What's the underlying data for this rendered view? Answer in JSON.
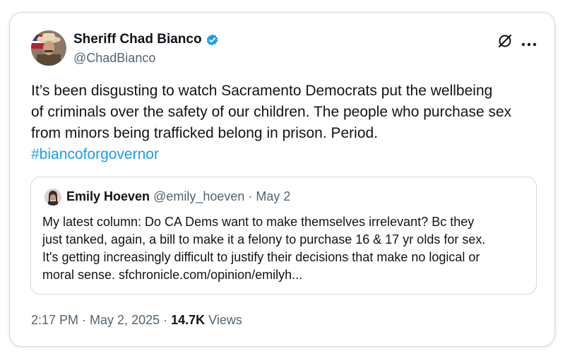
{
  "author": {
    "name": "Sheriff Chad Bianco",
    "handle": "@ChadBianco"
  },
  "tweet": {
    "text_lines": [
      "It’s been disgusting to watch Sacramento Democrats put the wellbeing",
      "of criminals over the safety of our children. The people who purchase sex",
      "from minors being trafficked belong in prison. Period."
    ],
    "hashtag": "#biancoforgovernor"
  },
  "quoted": {
    "name": "Emily Hoeven",
    "handle": "@emily_hoeven",
    "separator": " · ",
    "date": "May 2",
    "text_lines": [
      "My latest column: Do CA Dems want to make themselves irrelevant? Bc they",
      "just tanked, again, a bill to make it a felony to purchase 16 & 17 yr olds for sex.",
      "It's getting increasingly difficult to justify their decisions that make no logical or",
      "moral sense. sfchronicle.com/opinion/emilyh..."
    ]
  },
  "footer": {
    "time": "2:17 PM",
    "separator": " · ",
    "date": "May 2, 2025",
    "views_count": "14.7K",
    "views_label": " Views"
  },
  "icons": {
    "verified": "verified-badge-icon",
    "grok": "grok-icon",
    "more": "more-icon"
  },
  "colors": {
    "text": "#0f1419",
    "secondary": "#536471",
    "link": "#1d9bf0",
    "border": "#cfd9de"
  }
}
